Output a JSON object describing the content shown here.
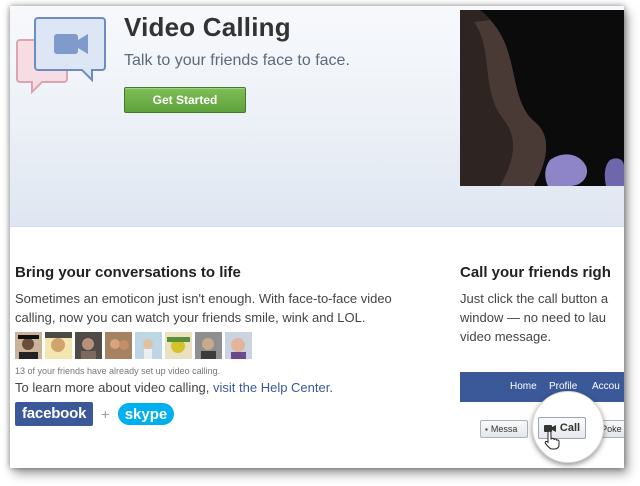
{
  "hero": {
    "title": "Video Calling",
    "subtitle": "Talk to your friends face to face.",
    "button_label": "Get Started"
  },
  "left": {
    "heading": "Bring your conversations to life",
    "body": "Sometimes an emoticon just isn't enough. With face-to-face video calling, now you can watch your friends smile, wink and LOL.",
    "friends_note": "13 of your friends have already set up video calling.",
    "learn_prefix": "To learn more about video calling, ",
    "learn_link": "visit the Help Center",
    "learn_suffix": ".",
    "facebook_logo": "facebook",
    "plus": "+",
    "skype_logo": "skype"
  },
  "right": {
    "heading": "Call your friends righ",
    "line1": "Just click the call button a",
    "line2": "window — no need to lau",
    "line3": "video message."
  },
  "mini_ui": {
    "nav": [
      "Home",
      "Profile",
      "Accou"
    ],
    "message_label": "Messa",
    "call_label": "Call",
    "poke_label": "Poke"
  },
  "colors": {
    "facebook_blue": "#3b5998",
    "button_green": "#67a844",
    "skype_blue": "#00aff0"
  }
}
